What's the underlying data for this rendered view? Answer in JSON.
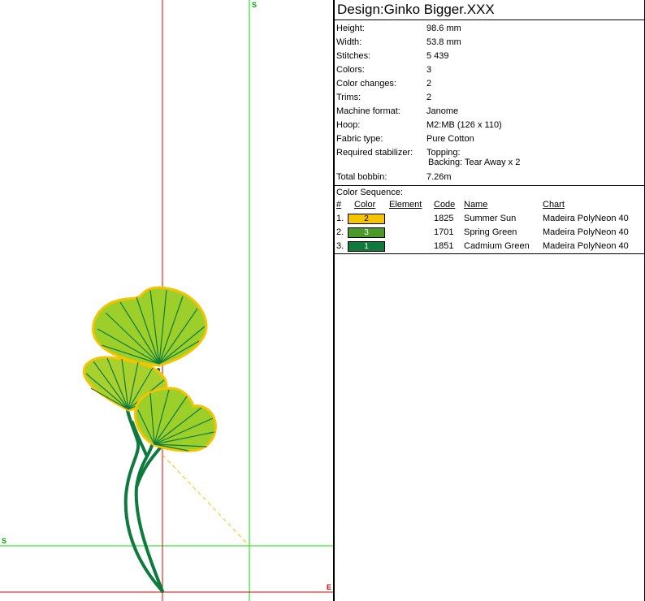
{
  "canvas": {
    "guide_color": "#00dd00",
    "axis_color": "#dd0000",
    "markers": {
      "start_top": "S",
      "start_left": "S",
      "end_right": "E"
    },
    "colors": {
      "sun": "#f5c400",
      "spring": "#4a9a2a",
      "cadmium": "#0e7a3e"
    }
  },
  "title": "Design:Ginko Bigger.XXX",
  "props": [
    {
      "label": "Height:",
      "value": "98.6 mm"
    },
    {
      "label": "Width:",
      "value": "53.8 mm"
    },
    {
      "label": "Stitches:",
      "value": "5 439"
    },
    {
      "label": "Colors:",
      "value": "3"
    },
    {
      "label": "Color changes:",
      "value": "2"
    },
    {
      "label": "Trims:",
      "value": "2"
    },
    {
      "label": "Machine format:",
      "value": "Janome"
    },
    {
      "label": "Hoop:",
      "value": "M2:MB (126 x 110)"
    },
    {
      "label": "Fabric type:",
      "value": "Pure Cotton"
    }
  ],
  "stabilizer": {
    "label": "Required stabilizer:",
    "line1": "Topping:",
    "line2": "Backing: Tear Away x 2"
  },
  "bobbin": {
    "label": "Total bobbin:",
    "value": "7.26m"
  },
  "sequence": {
    "title": "Color Sequence:",
    "headers": {
      "num": "#",
      "color": "Color",
      "element": "Element",
      "code": "Code",
      "name": "Name",
      "chart": "Chart"
    },
    "rows": [
      {
        "num": "1.",
        "swatch": "2",
        "hex": "#f5c400",
        "text": "#000000",
        "code": "1825",
        "name": "Summer Sun",
        "chart": "Madeira PolyNeon 40"
      },
      {
        "num": "2.",
        "swatch": "3",
        "hex": "#4a9a2a",
        "text": "#ffffff",
        "code": "1701",
        "name": "Spring Green",
        "chart": "Madeira PolyNeon 40"
      },
      {
        "num": "3.",
        "swatch": "1",
        "hex": "#0e7a3e",
        "text": "#ffffff",
        "code": "1851",
        "name": "Cadmium Green",
        "chart": "Madeira PolyNeon 40"
      }
    ]
  }
}
